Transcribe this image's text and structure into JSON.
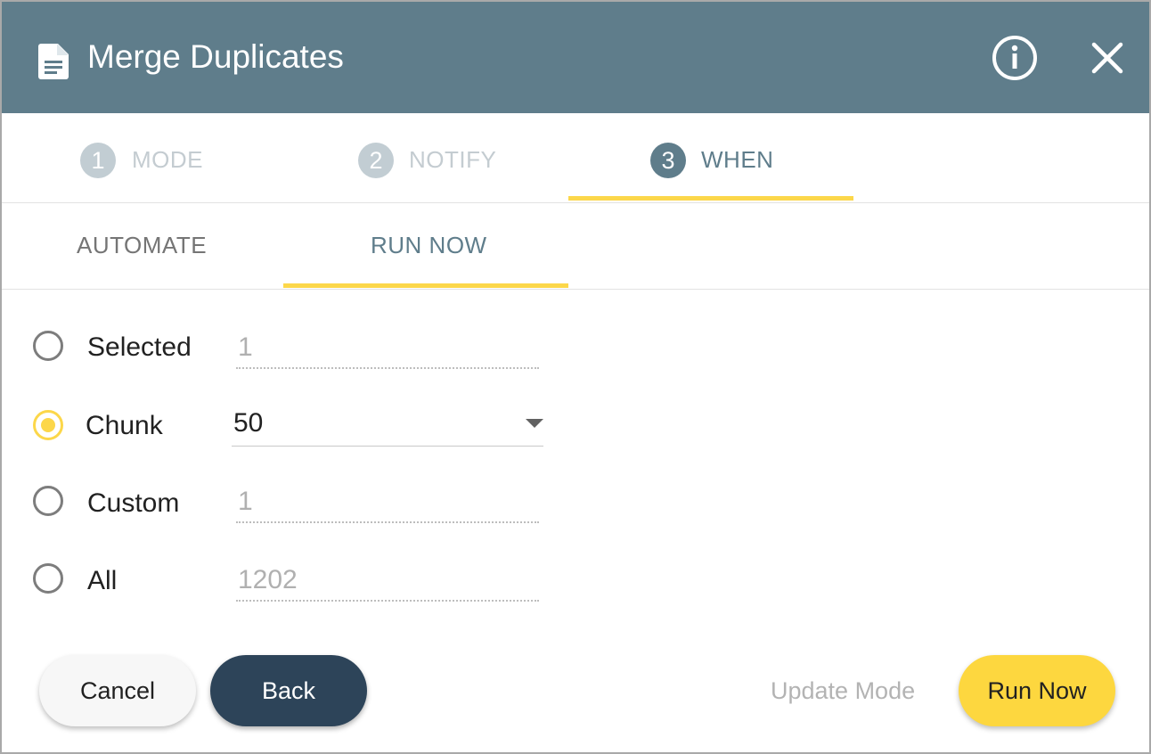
{
  "dialog": {
    "title": "Merge Duplicates",
    "icons": {
      "title": "document-icon",
      "info": "info-icon",
      "close": "close-icon"
    }
  },
  "steps": [
    {
      "number": "1",
      "label": "MODE",
      "state": "inactive"
    },
    {
      "number": "2",
      "label": "NOTIFY",
      "state": "inactive"
    },
    {
      "number": "3",
      "label": "WHEN",
      "state": "active"
    }
  ],
  "subtabs": [
    {
      "label": "AUTOMATE",
      "active": false
    },
    {
      "label": "RUN NOW",
      "active": true
    }
  ],
  "options": [
    {
      "label": "Selected",
      "value": "1",
      "checked": false,
      "type": "input"
    },
    {
      "label": "Chunk",
      "value": "50",
      "checked": true,
      "type": "select"
    },
    {
      "label": "Custom",
      "value": "1",
      "checked": false,
      "type": "input"
    },
    {
      "label": "All",
      "value": "1202",
      "checked": false,
      "type": "input"
    }
  ],
  "footer": {
    "cancel_label": "Cancel",
    "back_label": "Back",
    "update_mode_label": "Update Mode",
    "run_now_label": "Run Now"
  },
  "colors": {
    "header_bg": "#5f7d8b",
    "accent_yellow": "#fcd74a",
    "back_button": "#2d4459",
    "run_button": "#fdd73f"
  }
}
